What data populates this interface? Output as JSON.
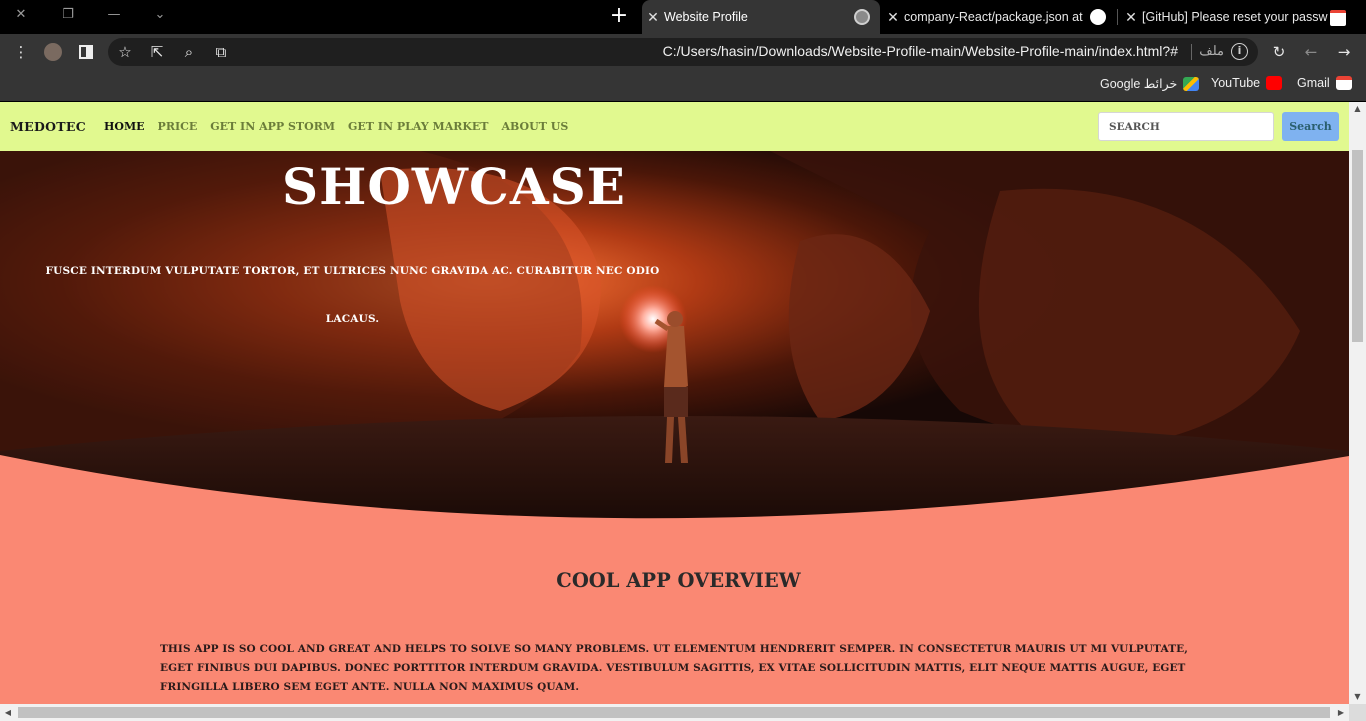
{
  "browser": {
    "tabs": [
      {
        "title": "Website Profile",
        "active": true
      },
      {
        "title": "company-React/package.json at",
        "active": false
      },
      {
        "title": "[GitHub] Please reset your passw",
        "active": false
      }
    ],
    "address": "C:/Users/hasin/Downloads/Website-Profile-main/Website-Profile-main/index.html?#",
    "file_label": "ملف",
    "bookmarks": [
      "Google خرائط",
      "YouTube",
      "Gmail"
    ]
  },
  "page": {
    "brand": "MEDOTEC",
    "nav": [
      "HOME",
      "PRICE",
      "GET IN APP STORM",
      "GET IN PLAY MARKET",
      "ABOUT US"
    ],
    "search": {
      "placeholder": "SEARCH",
      "button": "Search"
    },
    "hero": {
      "title": "SHOWCASE",
      "subtitle": "FUSCE INTERDUM VULPUTATE TORTOR, ET ULTRICES NUNC GRAVIDA AC. CURABITUR NEC ODIO LACAUS."
    },
    "overview": {
      "title": "COOL APP OVERVIEW",
      "text": "THIS APP IS SO COOL AND GREAT AND HELPS TO SOLVE SO MANY PROBLEMS. UT ELEMENTUM HENDRERIT SEMPER. IN CONSECTETUR MAURIS UT MI VULPUTATE, EGET FINIBUS DUI DAPIBUS. DONEC PORTTITOR INTERDUM GRAVIDA. VESTIBULUM SAGITTIS, EX VITAE SOLLICITUDIN MATTIS, ELIT NEQUE MATTIS AUGUE, EGET FRINGILLA LIBERO SEM EGET ANTE. NULLA NON MAXIMUS QUAM."
    }
  },
  "colors": {
    "navbar": "#e1f98f",
    "page_background": "#fa8873",
    "search_button": "#7fb2f0"
  }
}
